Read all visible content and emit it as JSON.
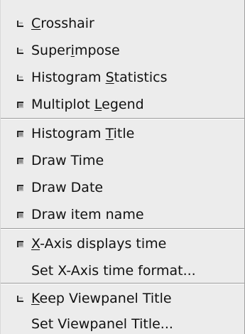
{
  "menu": {
    "items": [
      {
        "pre": "",
        "key": "C",
        "post": "rosshair",
        "state": "off"
      },
      {
        "pre": "Super",
        "key": "i",
        "post": "mpose",
        "state": "off"
      },
      {
        "pre": "Histogram ",
        "key": "S",
        "post": "tatistics",
        "state": "off"
      },
      {
        "pre": "Multiplot ",
        "key": "L",
        "post": "egend",
        "state": "on"
      },
      {
        "pre": "Histogram ",
        "key": "T",
        "post": "itle",
        "state": "on"
      },
      {
        "pre": "Draw Time",
        "key": "",
        "post": "",
        "state": "on"
      },
      {
        "pre": "Draw Date",
        "key": "",
        "post": "",
        "state": "on"
      },
      {
        "pre": "Draw item name",
        "key": "",
        "post": "",
        "state": "on"
      },
      {
        "pre": "",
        "key": "X",
        "post": "-Axis displays time",
        "state": "on"
      },
      {
        "pre": "Set X-Axis time format...",
        "key": "",
        "post": "",
        "state": "none"
      },
      {
        "pre": "",
        "key": "K",
        "post": "eep Viewpanel Title",
        "state": "off"
      },
      {
        "pre": "Set Viewpanel Title...",
        "key": "",
        "post": "",
        "state": "none"
      }
    ]
  }
}
